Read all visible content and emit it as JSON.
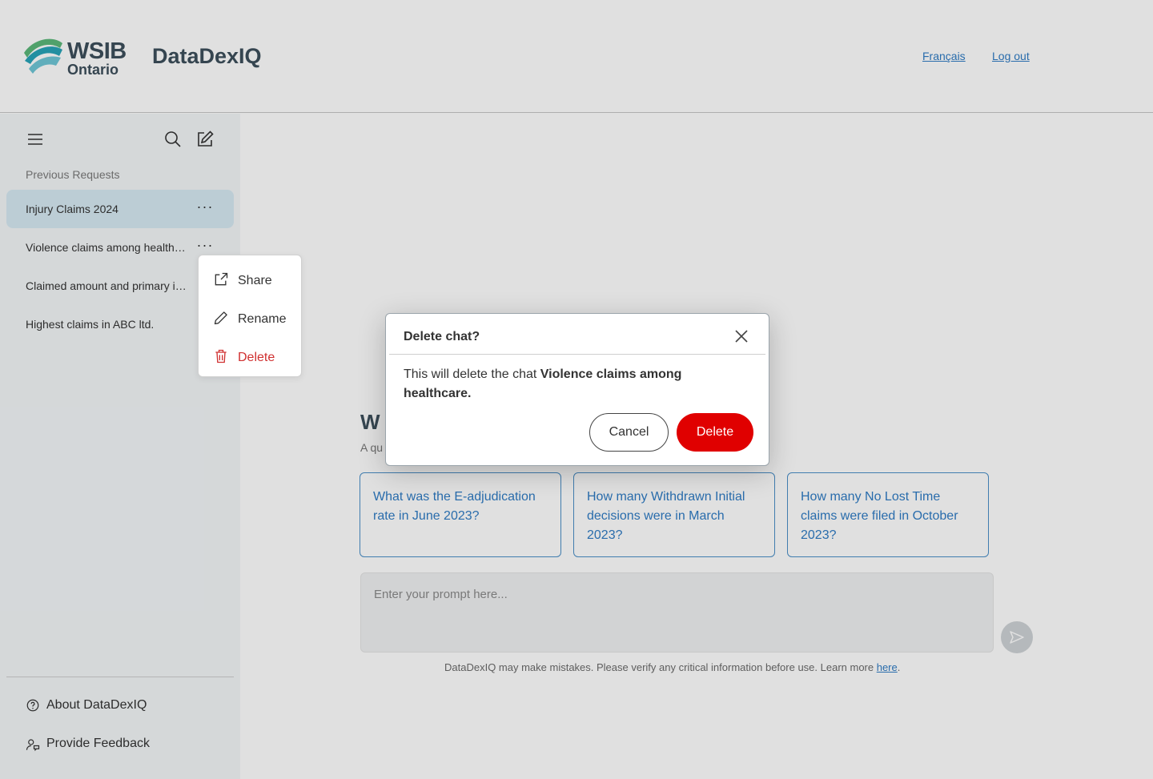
{
  "header": {
    "logo_line1": "WSIB",
    "logo_line2": "Ontario",
    "app_title": "DataDexIQ",
    "links": [
      "Français",
      "Log out"
    ]
  },
  "sidebar": {
    "heading": "Previous Requests",
    "items": [
      {
        "label": "Injury Claims 2024",
        "active": true
      },
      {
        "label": "Violence claims among healthcare",
        "active": false
      },
      {
        "label": "Claimed amount and primary injuries",
        "active": false
      },
      {
        "label": "Highest claims in ABC ltd.",
        "active": false
      }
    ],
    "more_glyph": "···",
    "footer": [
      {
        "label": "About DataDexIQ",
        "icon": "help-circle-icon"
      },
      {
        "label": "Provide Feedback",
        "icon": "user-feedback-icon"
      }
    ]
  },
  "context_menu": {
    "items": [
      {
        "label": "Share",
        "icon": "share-icon"
      },
      {
        "label": "Rename",
        "icon": "pencil-icon"
      },
      {
        "label": "Delete",
        "icon": "trash-icon"
      }
    ]
  },
  "main": {
    "welcome_heading": "W",
    "welcome_sub": "A qu",
    "suggestions": [
      "What was the E-adjudication rate in June 2023?",
      "How many Withdrawn Initial decisions were in March 2023?",
      "How many No Lost Time claims were filed in October 2023?"
    ],
    "prompt_placeholder": "Enter your prompt here...",
    "disclaimer": "DataDexIQ may make mistakes. Please verify any critical information before use. Learn more ",
    "disclaimer_link": "here",
    "disclaimer_end": "."
  },
  "modal": {
    "title": "Delete chat?",
    "body_prefix": "This will delete the chat ",
    "body_bold": "Violence claims among healthcare.",
    "cancel_label": "Cancel",
    "delete_label": "Delete"
  },
  "colors": {
    "accent": "#2f7cc4",
    "danger": "#e00000",
    "active_item": "#d7eaf3",
    "brand_text": "#3d4f5c"
  }
}
